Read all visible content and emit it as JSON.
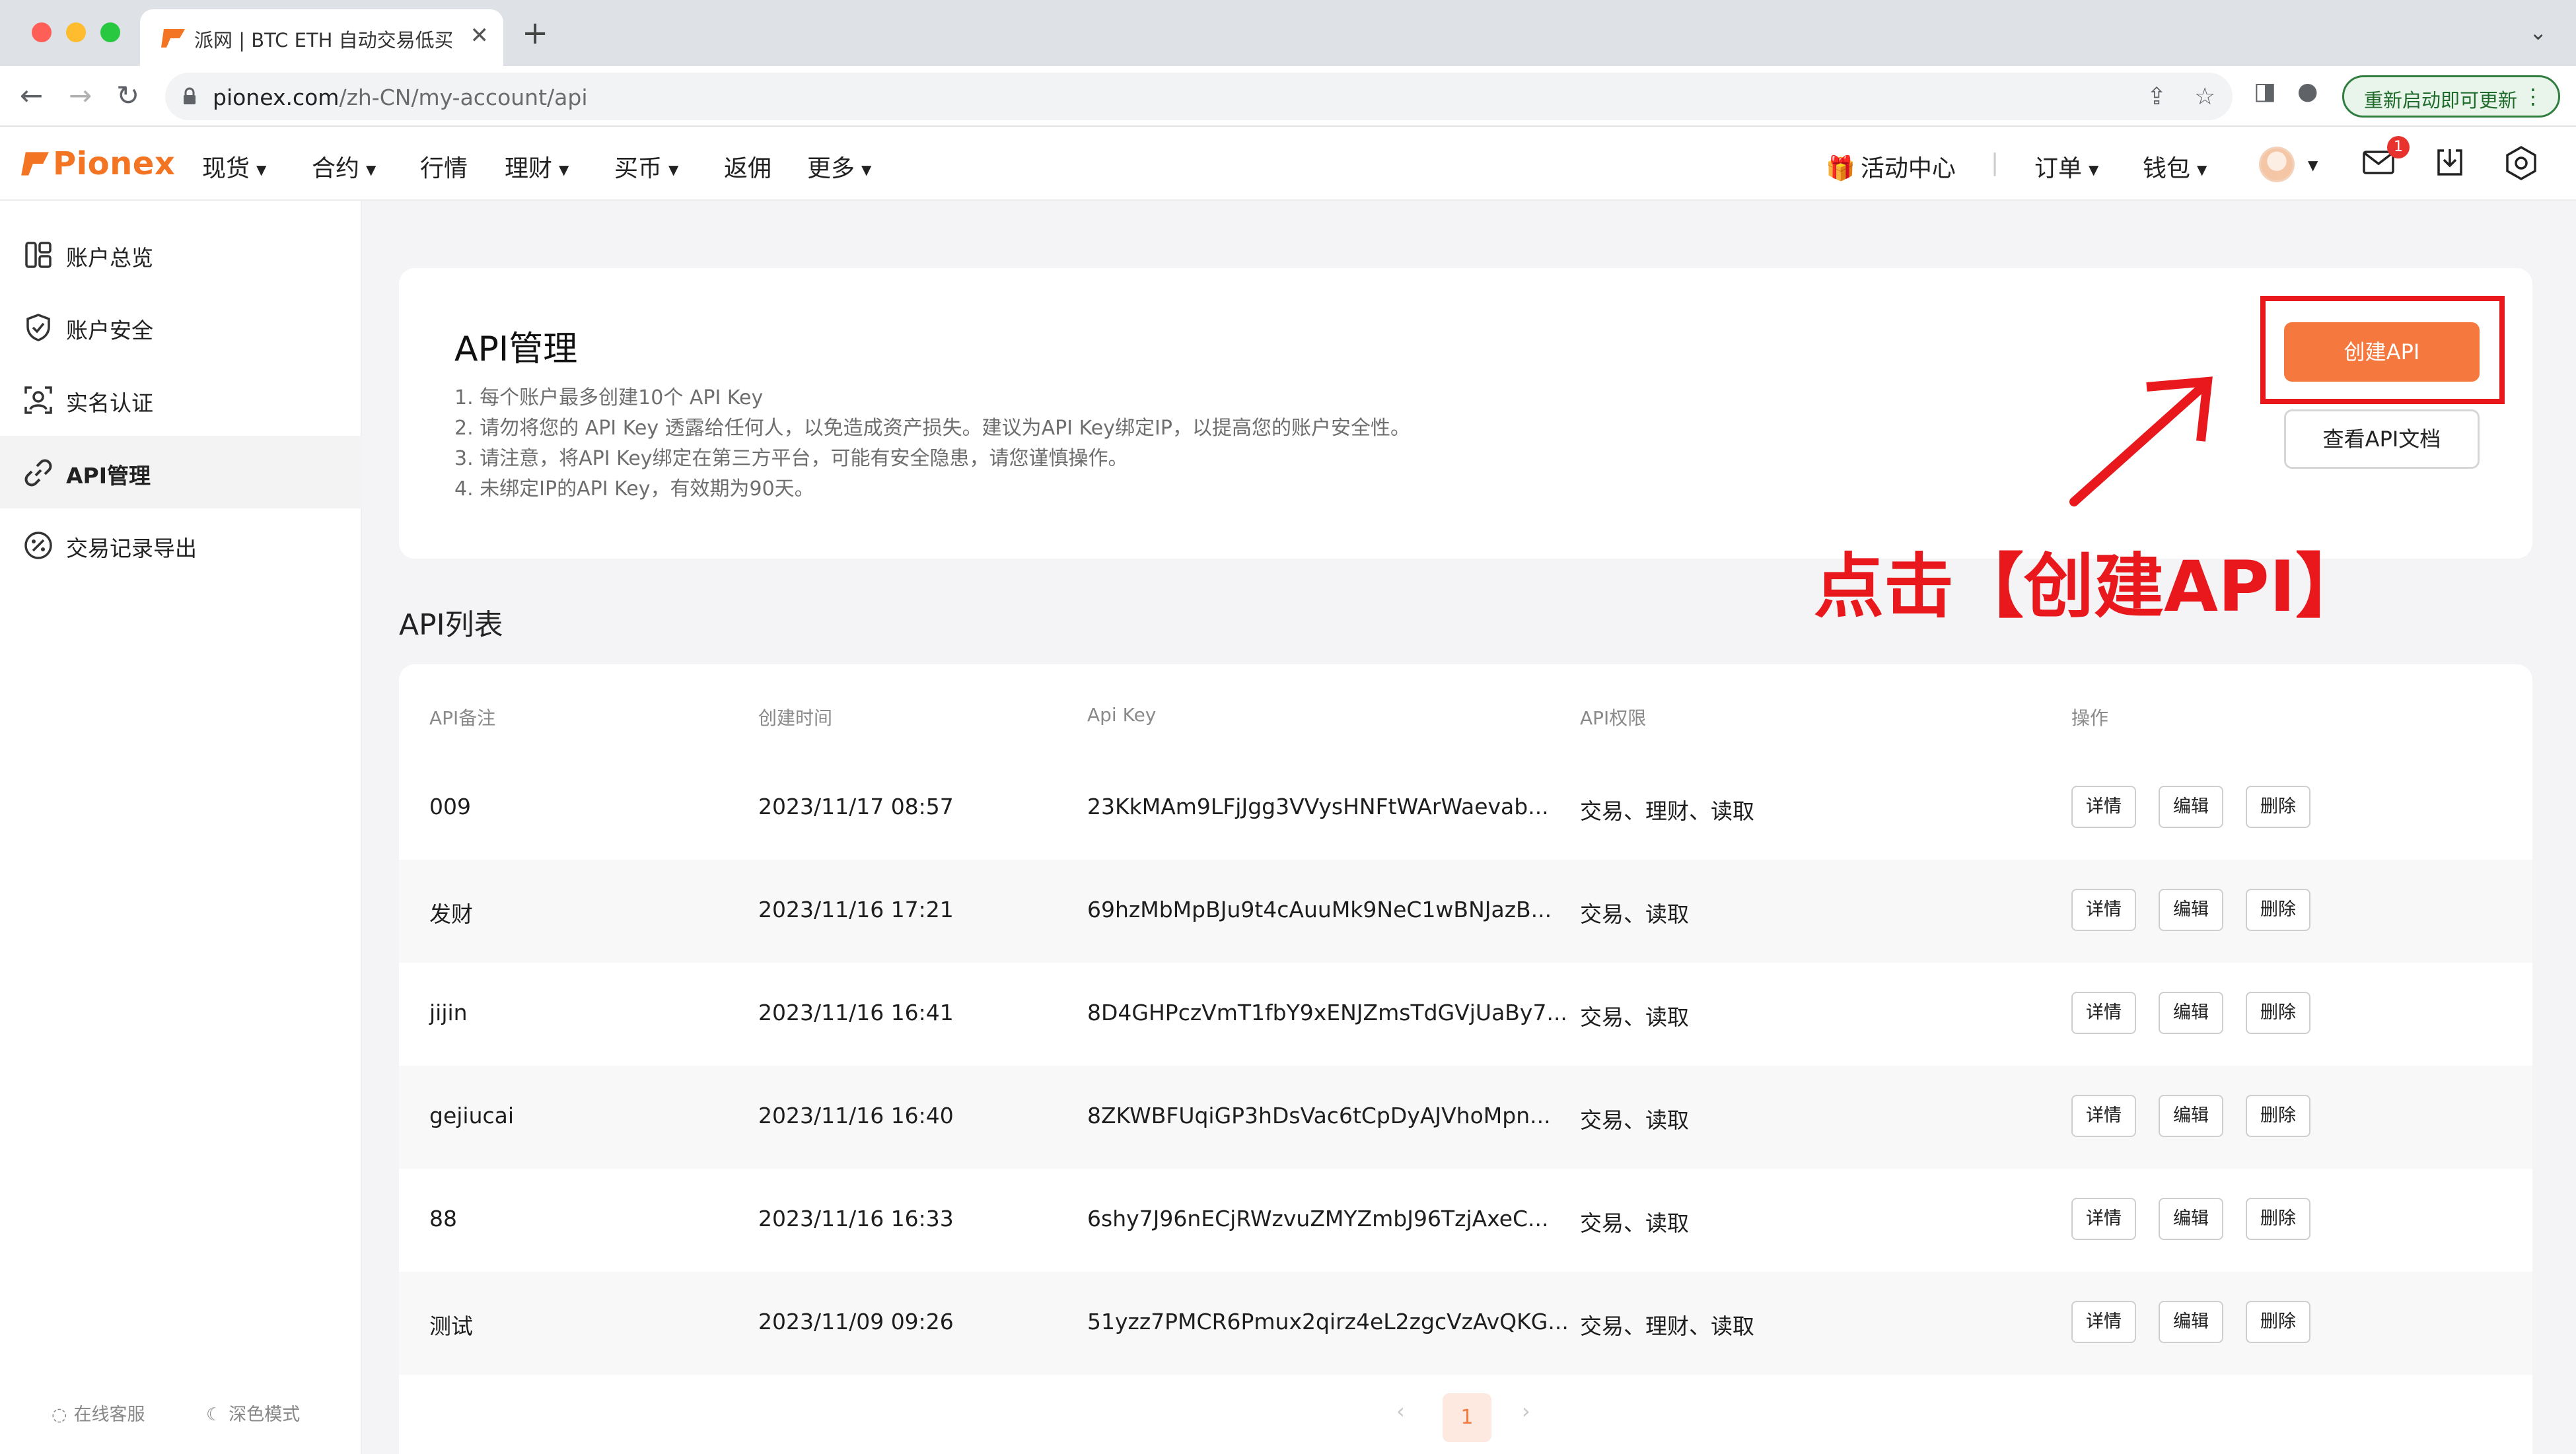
{
  "browser": {
    "tab_title": "派网 | BTC ETH 自动交易低买高",
    "tab_close": "✕",
    "new_tab": "+",
    "url_host": "pionex.com",
    "url_path": "/zh-CN/my-account/api",
    "update_label": "重新启动即可更新",
    "traffic_colors": [
      "#ff5f57",
      "#febc2e",
      "#28c840"
    ]
  },
  "header": {
    "logo": "Pionex",
    "nav": [
      "现货",
      "合约",
      "行情",
      "理财",
      "买币",
      "返佣",
      "更多"
    ],
    "activity_center": "活动中心",
    "orders": "订单",
    "wallet": "钱包",
    "mail_badge": "1"
  },
  "sidebar": {
    "items": [
      {
        "label": "账户总览",
        "icon": "dashboard-icon"
      },
      {
        "label": "账户安全",
        "icon": "shield-icon"
      },
      {
        "label": "实名认证",
        "icon": "id-verify-icon"
      },
      {
        "label": "API管理",
        "icon": "link-icon",
        "active": true
      },
      {
        "label": "交易记录导出",
        "icon": "percent-icon"
      }
    ],
    "footer": {
      "support": "在线客服",
      "dark_mode": "深色模式"
    }
  },
  "api_card": {
    "title": "API管理",
    "notes": [
      "1. 每个账户最多创建10个 API Key",
      "2. 请勿将您的 API Key 透露给任何人，以免造成资产损失。建议为API Key绑定IP，以提高您的账户安全性。",
      "3. 请注意，将API Key绑定在第三方平台，可能有安全隐患，请您谨慎操作。",
      "4. 未绑定IP的API Key，有效期为90天。"
    ],
    "create_button": "创建API",
    "docs_button": "查看API文档"
  },
  "annotation": "点击【创建API】",
  "list": {
    "title": "API列表",
    "headers": [
      "API备注",
      "创建时间",
      "Api Key",
      "API权限",
      "操作"
    ],
    "actions": {
      "detail": "详情",
      "edit": "编辑",
      "delete": "删除"
    },
    "rows": [
      {
        "note": "009",
        "created": "2023/11/17 08:57",
        "key": "23KkMAm9LFjJgg3VVysHNFtWArWaevab...",
        "perms": "交易、理财、读取"
      },
      {
        "note": "发财",
        "created": "2023/11/16 17:21",
        "key": "69hzMbMpBJu9t4cAuuMk9NeC1wBNJazB...",
        "perms": "交易、读取"
      },
      {
        "note": "jijin",
        "created": "2023/11/16 16:41",
        "key": "8D4GHPczVmT1fbY9xENJZmsTdGVjUaBy7...",
        "perms": "交易、读取"
      },
      {
        "note": "gejiucai",
        "created": "2023/11/16 16:40",
        "key": "8ZKWBFUqiGP3hDsVac6tCpDyAJVhoMpn...",
        "perms": "交易、读取"
      },
      {
        "note": "88",
        "created": "2023/11/16 16:33",
        "key": "6shy7J96nECjRWzvuZMYZmbJ96TzjAxeC...",
        "perms": "交易、读取"
      },
      {
        "note": "测试",
        "created": "2023/11/09 09:26",
        "key": "51yzz7PMCR6Pmux2qirz4eL2zgcVzAvQKG...",
        "perms": "交易、理财、读取"
      }
    ],
    "pagination": {
      "prev": "‹",
      "current": "1",
      "next": "›"
    }
  },
  "colors": {
    "brand": "#f37423",
    "create_button": "#f5793e",
    "annotation_red": "#e8181c"
  }
}
